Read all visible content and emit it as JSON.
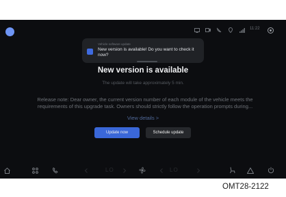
{
  "status_bar": {
    "time": "11:22",
    "icons": [
      "screen-icon",
      "camera-icon",
      "phone-mute-icon",
      "location-icon",
      "signal-icon",
      "user-icon"
    ]
  },
  "notification": {
    "app_name": "Vehicle software update",
    "message": "New version is available! Do you want to check it now?",
    "icon": "update-app-icon"
  },
  "main": {
    "title": "New version is available",
    "subtitle": "The update will take approximately 5 min.",
    "release_note_line1": "Release note: Dear owner, the current version number of each module of the vehicle meets the",
    "release_note_line2": "requirements of this upgrade task. Owners should strictly follow the operation prompts during...",
    "view_details": "View details >"
  },
  "buttons": {
    "update_now": "Update now",
    "schedule_update": "Schedule update"
  },
  "dock": {
    "left_temp": "LO",
    "right_temp": "LO",
    "icons": [
      "home-icon",
      "apps-icon",
      "phone-icon",
      "fan-icon",
      "seat-icon",
      "warning-icon",
      "power-icon"
    ]
  },
  "caption": "OMT28-2122",
  "colors": {
    "screen_bg": "#0c0d10",
    "accent": "#3a67d8",
    "link": "#516a9a"
  }
}
